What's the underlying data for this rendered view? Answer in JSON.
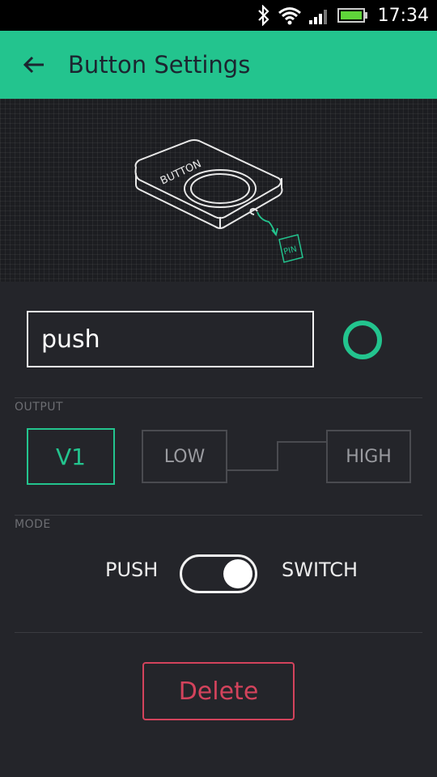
{
  "status_bar": {
    "time": "17:34",
    "icons": [
      "bluetooth-icon",
      "wifi-icon",
      "signal-icon",
      "battery-icon"
    ]
  },
  "app_bar": {
    "title": "Button Settings",
    "back_icon": "arrow-left-icon"
  },
  "illustration": {
    "device_label": "BUTTON",
    "pin_label": "PIN"
  },
  "widget": {
    "name_value": "push",
    "color": "#23c48e"
  },
  "output": {
    "section_label": "OUTPUT",
    "pin": "V1",
    "low_label": "LOW",
    "high_label": "HIGH"
  },
  "mode": {
    "section_label": "MODE",
    "left_label": "PUSH",
    "right_label": "SWITCH",
    "selected": "SWITCH"
  },
  "actions": {
    "delete_label": "Delete"
  },
  "colors": {
    "accent": "#23c48e",
    "danger": "#d3435c",
    "background": "#24252a"
  }
}
